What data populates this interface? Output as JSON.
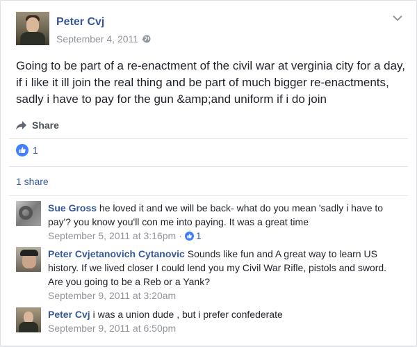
{
  "colors": {
    "link": "#365899",
    "meta": "#90949c",
    "text": "#1d2129",
    "like_blue": "#4080ff"
  },
  "post": {
    "author": "Peter Cvj",
    "date": "September 4, 2011 ·",
    "privacy_icon": "globe-icon",
    "text": "Going to be part of a re-enactment of the civil war at verginia city for a day, if i like it ill join the real thing and be part of much bigger re-enactments, sadly i have to pay for the gun &amp;and uniform if i do join",
    "share_label": "Share",
    "like_count": "1",
    "shares_text": "1 share"
  },
  "comments": [
    {
      "author": "Sue Gross",
      "text": " he loved it and we will be back- what do you mean 'sadly i have to pay'? you know you'll con me into paying. It was a great time",
      "timestamp": "September 5, 2011 at 3:16pm",
      "likes": "1"
    },
    {
      "author": "Peter Cvjetanovich Cytanovic",
      "text": " Sounds like fun and A great way to learn US history. If we lived closer I could lend you my Civil War Rifle, pistols and sword. Are you going to be a Reb or a Yank?",
      "timestamp": "September 9, 2011 at 3:20am"
    },
    {
      "author": "Peter Cvj",
      "text": " i was a union dude , but i prefer confederate",
      "timestamp": "September 9, 2011 at 6:50pm"
    }
  ]
}
